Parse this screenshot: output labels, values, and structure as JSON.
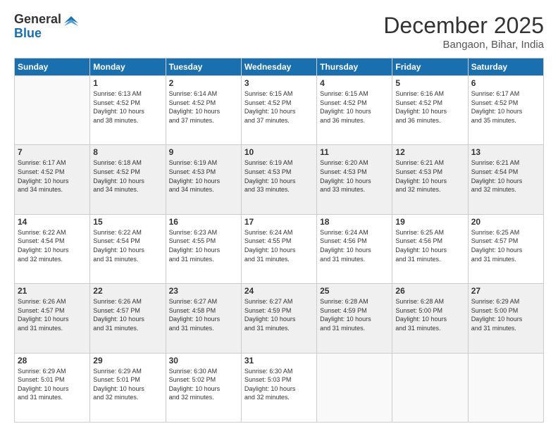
{
  "logo": {
    "general": "General",
    "blue": "Blue"
  },
  "header": {
    "month_year": "December 2025",
    "location": "Bangaon, Bihar, India"
  },
  "days_of_week": [
    "Sunday",
    "Monday",
    "Tuesday",
    "Wednesday",
    "Thursday",
    "Friday",
    "Saturday"
  ],
  "weeks": [
    [
      {
        "day": "",
        "info": ""
      },
      {
        "day": "1",
        "info": "Sunrise: 6:13 AM\nSunset: 4:52 PM\nDaylight: 10 hours\nand 38 minutes."
      },
      {
        "day": "2",
        "info": "Sunrise: 6:14 AM\nSunset: 4:52 PM\nDaylight: 10 hours\nand 37 minutes."
      },
      {
        "day": "3",
        "info": "Sunrise: 6:15 AM\nSunset: 4:52 PM\nDaylight: 10 hours\nand 37 minutes."
      },
      {
        "day": "4",
        "info": "Sunrise: 6:15 AM\nSunset: 4:52 PM\nDaylight: 10 hours\nand 36 minutes."
      },
      {
        "day": "5",
        "info": "Sunrise: 6:16 AM\nSunset: 4:52 PM\nDaylight: 10 hours\nand 36 minutes."
      },
      {
        "day": "6",
        "info": "Sunrise: 6:17 AM\nSunset: 4:52 PM\nDaylight: 10 hours\nand 35 minutes."
      }
    ],
    [
      {
        "day": "7",
        "info": "Sunrise: 6:17 AM\nSunset: 4:52 PM\nDaylight: 10 hours\nand 34 minutes."
      },
      {
        "day": "8",
        "info": "Sunrise: 6:18 AM\nSunset: 4:52 PM\nDaylight: 10 hours\nand 34 minutes."
      },
      {
        "day": "9",
        "info": "Sunrise: 6:19 AM\nSunset: 4:53 PM\nDaylight: 10 hours\nand 34 minutes."
      },
      {
        "day": "10",
        "info": "Sunrise: 6:19 AM\nSunset: 4:53 PM\nDaylight: 10 hours\nand 33 minutes."
      },
      {
        "day": "11",
        "info": "Sunrise: 6:20 AM\nSunset: 4:53 PM\nDaylight: 10 hours\nand 33 minutes."
      },
      {
        "day": "12",
        "info": "Sunrise: 6:21 AM\nSunset: 4:53 PM\nDaylight: 10 hours\nand 32 minutes."
      },
      {
        "day": "13",
        "info": "Sunrise: 6:21 AM\nSunset: 4:54 PM\nDaylight: 10 hours\nand 32 minutes."
      }
    ],
    [
      {
        "day": "14",
        "info": "Sunrise: 6:22 AM\nSunset: 4:54 PM\nDaylight: 10 hours\nand 32 minutes."
      },
      {
        "day": "15",
        "info": "Sunrise: 6:22 AM\nSunset: 4:54 PM\nDaylight: 10 hours\nand 31 minutes."
      },
      {
        "day": "16",
        "info": "Sunrise: 6:23 AM\nSunset: 4:55 PM\nDaylight: 10 hours\nand 31 minutes."
      },
      {
        "day": "17",
        "info": "Sunrise: 6:24 AM\nSunset: 4:55 PM\nDaylight: 10 hours\nand 31 minutes."
      },
      {
        "day": "18",
        "info": "Sunrise: 6:24 AM\nSunset: 4:56 PM\nDaylight: 10 hours\nand 31 minutes."
      },
      {
        "day": "19",
        "info": "Sunrise: 6:25 AM\nSunset: 4:56 PM\nDaylight: 10 hours\nand 31 minutes."
      },
      {
        "day": "20",
        "info": "Sunrise: 6:25 AM\nSunset: 4:57 PM\nDaylight: 10 hours\nand 31 minutes."
      }
    ],
    [
      {
        "day": "21",
        "info": "Sunrise: 6:26 AM\nSunset: 4:57 PM\nDaylight: 10 hours\nand 31 minutes."
      },
      {
        "day": "22",
        "info": "Sunrise: 6:26 AM\nSunset: 4:57 PM\nDaylight: 10 hours\nand 31 minutes."
      },
      {
        "day": "23",
        "info": "Sunrise: 6:27 AM\nSunset: 4:58 PM\nDaylight: 10 hours\nand 31 minutes."
      },
      {
        "day": "24",
        "info": "Sunrise: 6:27 AM\nSunset: 4:59 PM\nDaylight: 10 hours\nand 31 minutes."
      },
      {
        "day": "25",
        "info": "Sunrise: 6:28 AM\nSunset: 4:59 PM\nDaylight: 10 hours\nand 31 minutes."
      },
      {
        "day": "26",
        "info": "Sunrise: 6:28 AM\nSunset: 5:00 PM\nDaylight: 10 hours\nand 31 minutes."
      },
      {
        "day": "27",
        "info": "Sunrise: 6:29 AM\nSunset: 5:00 PM\nDaylight: 10 hours\nand 31 minutes."
      }
    ],
    [
      {
        "day": "28",
        "info": "Sunrise: 6:29 AM\nSunset: 5:01 PM\nDaylight: 10 hours\nand 31 minutes."
      },
      {
        "day": "29",
        "info": "Sunrise: 6:29 AM\nSunset: 5:01 PM\nDaylight: 10 hours\nand 32 minutes."
      },
      {
        "day": "30",
        "info": "Sunrise: 6:30 AM\nSunset: 5:02 PM\nDaylight: 10 hours\nand 32 minutes."
      },
      {
        "day": "31",
        "info": "Sunrise: 6:30 AM\nSunset: 5:03 PM\nDaylight: 10 hours\nand 32 minutes."
      },
      {
        "day": "",
        "info": ""
      },
      {
        "day": "",
        "info": ""
      },
      {
        "day": "",
        "info": ""
      }
    ]
  ]
}
